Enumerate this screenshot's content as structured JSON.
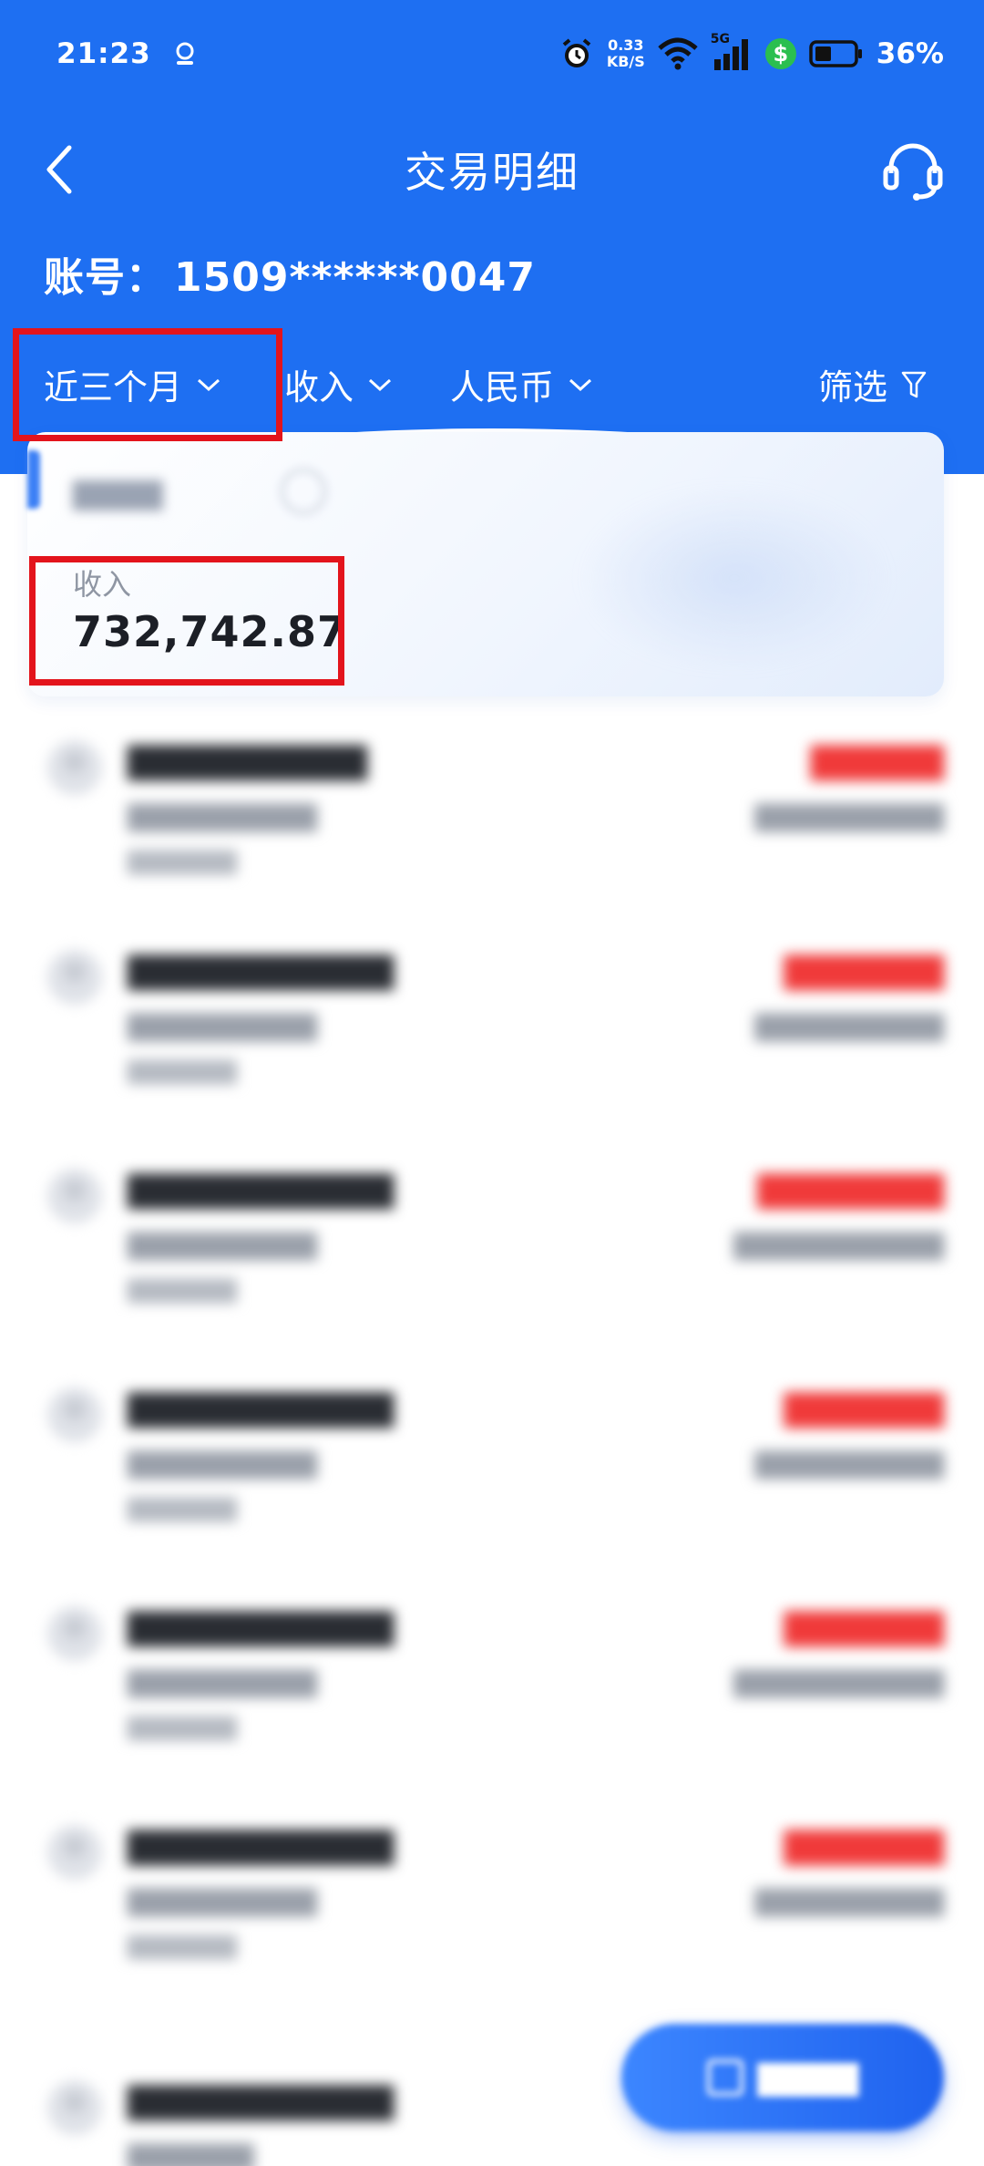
{
  "status_bar": {
    "time": "21:23",
    "net_speed_value": "0.33",
    "net_speed_unit": "KB/S",
    "signal_label": "5G",
    "battery": "36%"
  },
  "nav": {
    "title": "交易明细"
  },
  "account": {
    "label": "账号：",
    "number": "1509******0047"
  },
  "filters": {
    "period": "近三个月",
    "type": "收入",
    "currency": "人民币",
    "screen": "筛选"
  },
  "summary": {
    "label": "收入",
    "value": "732,742.87"
  },
  "colors": {
    "header_blue": "#1e6ff2",
    "highlight_red": "#e3141c",
    "amount_red": "#f03a3a"
  },
  "icons": [
    "back-arrow-icon",
    "customer-service-icon",
    "chevron-down-icon",
    "filter-funnel-icon",
    "alarm-icon",
    "wifi-icon",
    "signal-icon",
    "battery-icon"
  ]
}
